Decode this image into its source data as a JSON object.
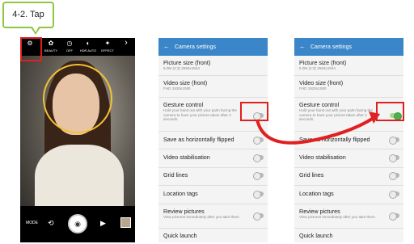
{
  "callout": {
    "label": "4-2. Tap"
  },
  "camera": {
    "toolbar": [
      {
        "icon": "gear-icon",
        "label": ""
      },
      {
        "icon": "beauty-icon",
        "label": "BEAUTY"
      },
      {
        "icon": "timer-icon",
        "label": "OFF"
      },
      {
        "icon": "hdr-icon",
        "label": "HDR AUTO"
      },
      {
        "icon": "effect-icon",
        "label": "EFFECT"
      },
      {
        "icon": "chevron-right-icon",
        "label": ""
      }
    ],
    "mode_label": "MODE"
  },
  "settings": {
    "header_title": "Camera settings",
    "items": [
      {
        "title": "Picture size (front)",
        "sub": "5.0M (4:3) 2592x1944",
        "toggle": null
      },
      {
        "title": "Video size (front)",
        "sub": "FHD 1920x1080",
        "toggle": null
      },
      {
        "title": "Gesture control",
        "sub": "Hold your hand out with your palm facing the camera to have your picture taken after 2 seconds.",
        "toggle": "gesture"
      },
      {
        "title": "Save as horizontally flipped",
        "sub": "",
        "toggle": "off"
      },
      {
        "title": "Video stabilisation",
        "sub": "",
        "toggle": "off"
      },
      {
        "title": "Grid lines",
        "sub": "",
        "toggle": "off"
      },
      {
        "title": "Location tags",
        "sub": "",
        "toggle": "off"
      },
      {
        "title": "Review pictures",
        "sub": "View pictures immediately after you take them.",
        "toggle": "off"
      },
      {
        "title": "Quick launch",
        "sub": "",
        "toggle": null
      }
    ],
    "gesture_before": false,
    "gesture_after": true
  },
  "colors": {
    "header": "#3a86c8",
    "highlight": "#e02020",
    "callout": "#8dc63f",
    "toggle_on": "#4caf50"
  }
}
